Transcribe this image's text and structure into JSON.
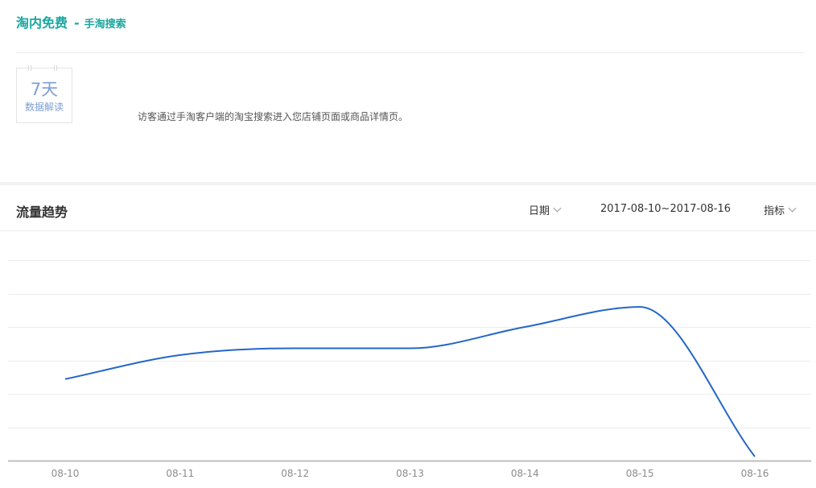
{
  "header": {
    "title": "淘内免费",
    "separator": "-",
    "subtitle": "手淘搜索"
  },
  "badge": {
    "days": "7天",
    "label": "数据解读"
  },
  "description": "访客通过手淘客户端的淘宝搜索进入您店铺页面或商品详情页。",
  "trend": {
    "title": "流量趋势",
    "date_dropdown": "日期",
    "date_range": "2017-08-10~2017-08-16",
    "metric_dropdown": "指标"
  },
  "colors": {
    "accent": "#1aa7a0",
    "line": "#2467c8",
    "badge": "#7d9ed6"
  },
  "chart_data": {
    "type": "line",
    "x": [
      "08-10",
      "08-11",
      "08-12",
      "08-13",
      "08-14",
      "08-15",
      "08-16"
    ],
    "series": [
      {
        "values": [
          61,
          79,
          84,
          84,
          100,
          115,
          3
        ]
      }
    ],
    "ylim": [
      0,
      150
    ],
    "grid": true,
    "legend": "none"
  }
}
